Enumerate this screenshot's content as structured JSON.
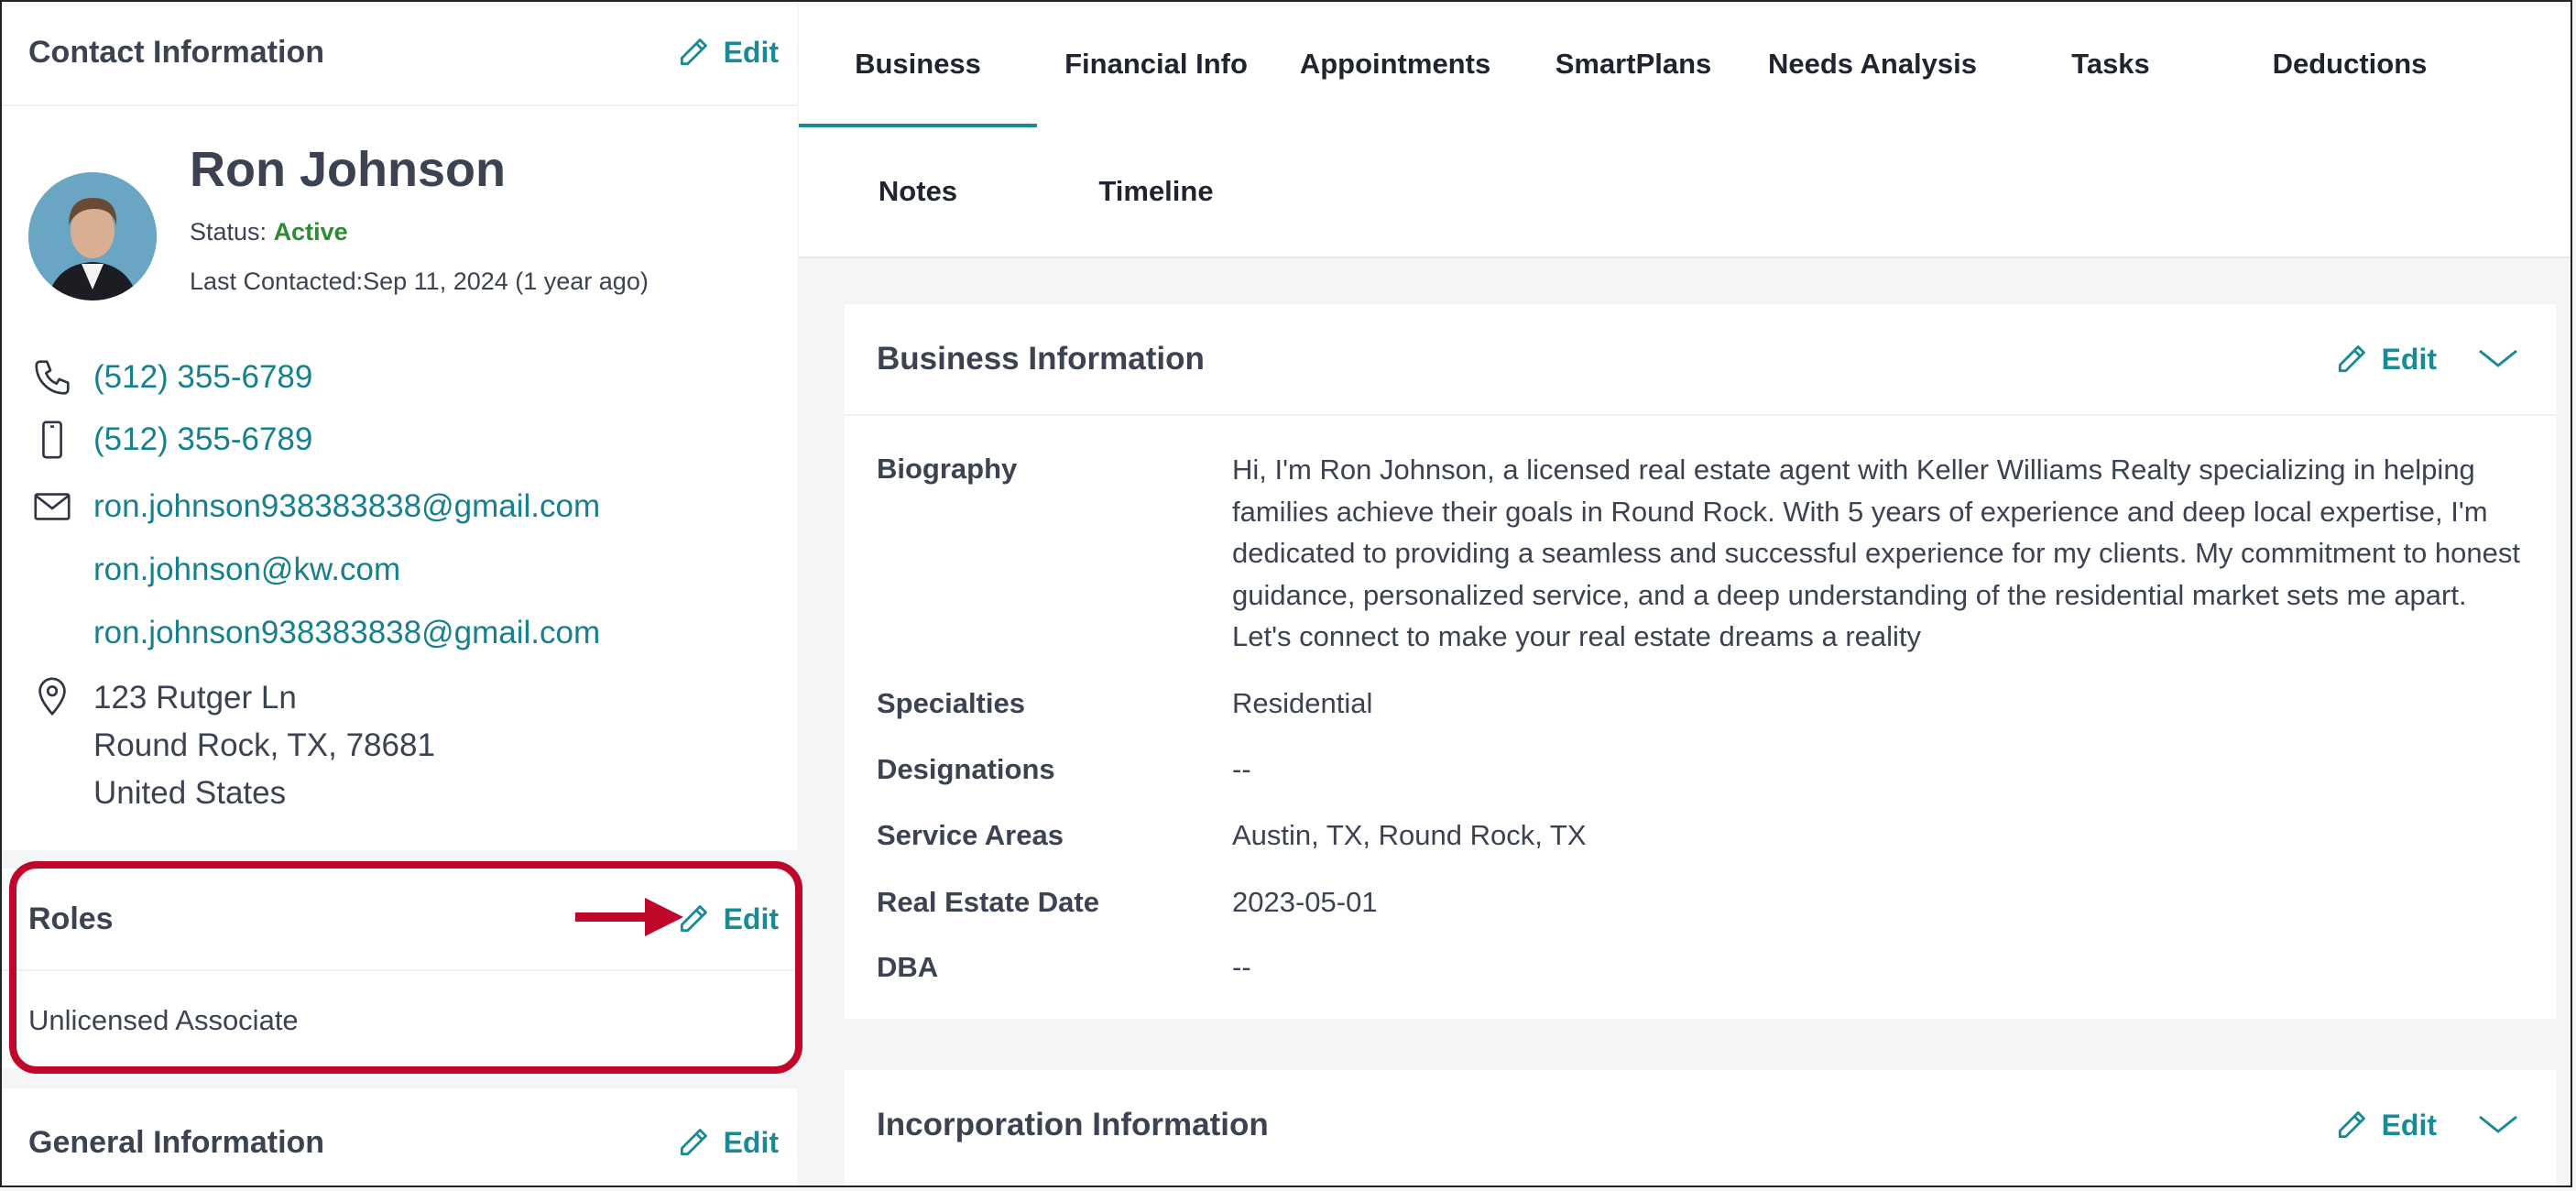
{
  "contact": {
    "title": "Contact Information",
    "edit_label": "Edit",
    "name": "Ron Johnson",
    "status_label": "Status:",
    "status_value": "Active",
    "last_contacted": "Last Contacted:Sep 11, 2024 (1 year ago)",
    "phone": "(512) 355-6789",
    "mobile": "(512) 355-6789",
    "email_1": "ron.johnson938383838@gmail.com",
    "email_2": "ron.johnson@kw.com",
    "email_3": "ron.johnson938383838@gmail.com",
    "address_line1": "123 Rutger Ln",
    "address_line2": "Round Rock, TX, 78681",
    "address_line3": "United States"
  },
  "roles": {
    "title": "Roles",
    "edit_label": "Edit",
    "value": "Unlicensed Associate"
  },
  "general": {
    "title": "General Information",
    "edit_label": "Edit"
  },
  "tabs": [
    {
      "label": "Business"
    },
    {
      "label": "Financial Info"
    },
    {
      "label": "Appointments"
    },
    {
      "label": "SmartPlans"
    },
    {
      "label": "Needs Analysis"
    },
    {
      "label": "Tasks"
    },
    {
      "label": "Deductions"
    },
    {
      "label": "Notes"
    },
    {
      "label": "Timeline"
    }
  ],
  "business": {
    "title": "Business Information",
    "edit_label": "Edit",
    "biography_label": "Biography",
    "biography": "Hi, I'm Ron Johnson, a licensed real estate agent with Keller Williams Realty specializing in helping families achieve their goals in Round Rock. With 5 years of experience and deep local expertise, I'm dedicated to providing a seamless and successful experience for my clients. My commitment to honest guidance, personalized service, and a deep understanding of the residential market sets me apart. Let's connect to make your real estate dreams a reality",
    "specialties_label": "Specialties",
    "specialties": "Residential",
    "designations_label": "Designations",
    "designations": "--",
    "service_areas_label": "Service Areas",
    "service_areas": "Austin, TX, Round Rock, TX",
    "real_estate_date_label": "Real Estate Date",
    "real_estate_date": "2023-05-01",
    "dba_label": "DBA",
    "dba": "--"
  },
  "incorporation": {
    "title": "Incorporation Information",
    "edit_label": "Edit"
  },
  "colors": {
    "accent": "#1a8a95",
    "active_status": "#2e8b32",
    "highlight": "#c0072a"
  }
}
